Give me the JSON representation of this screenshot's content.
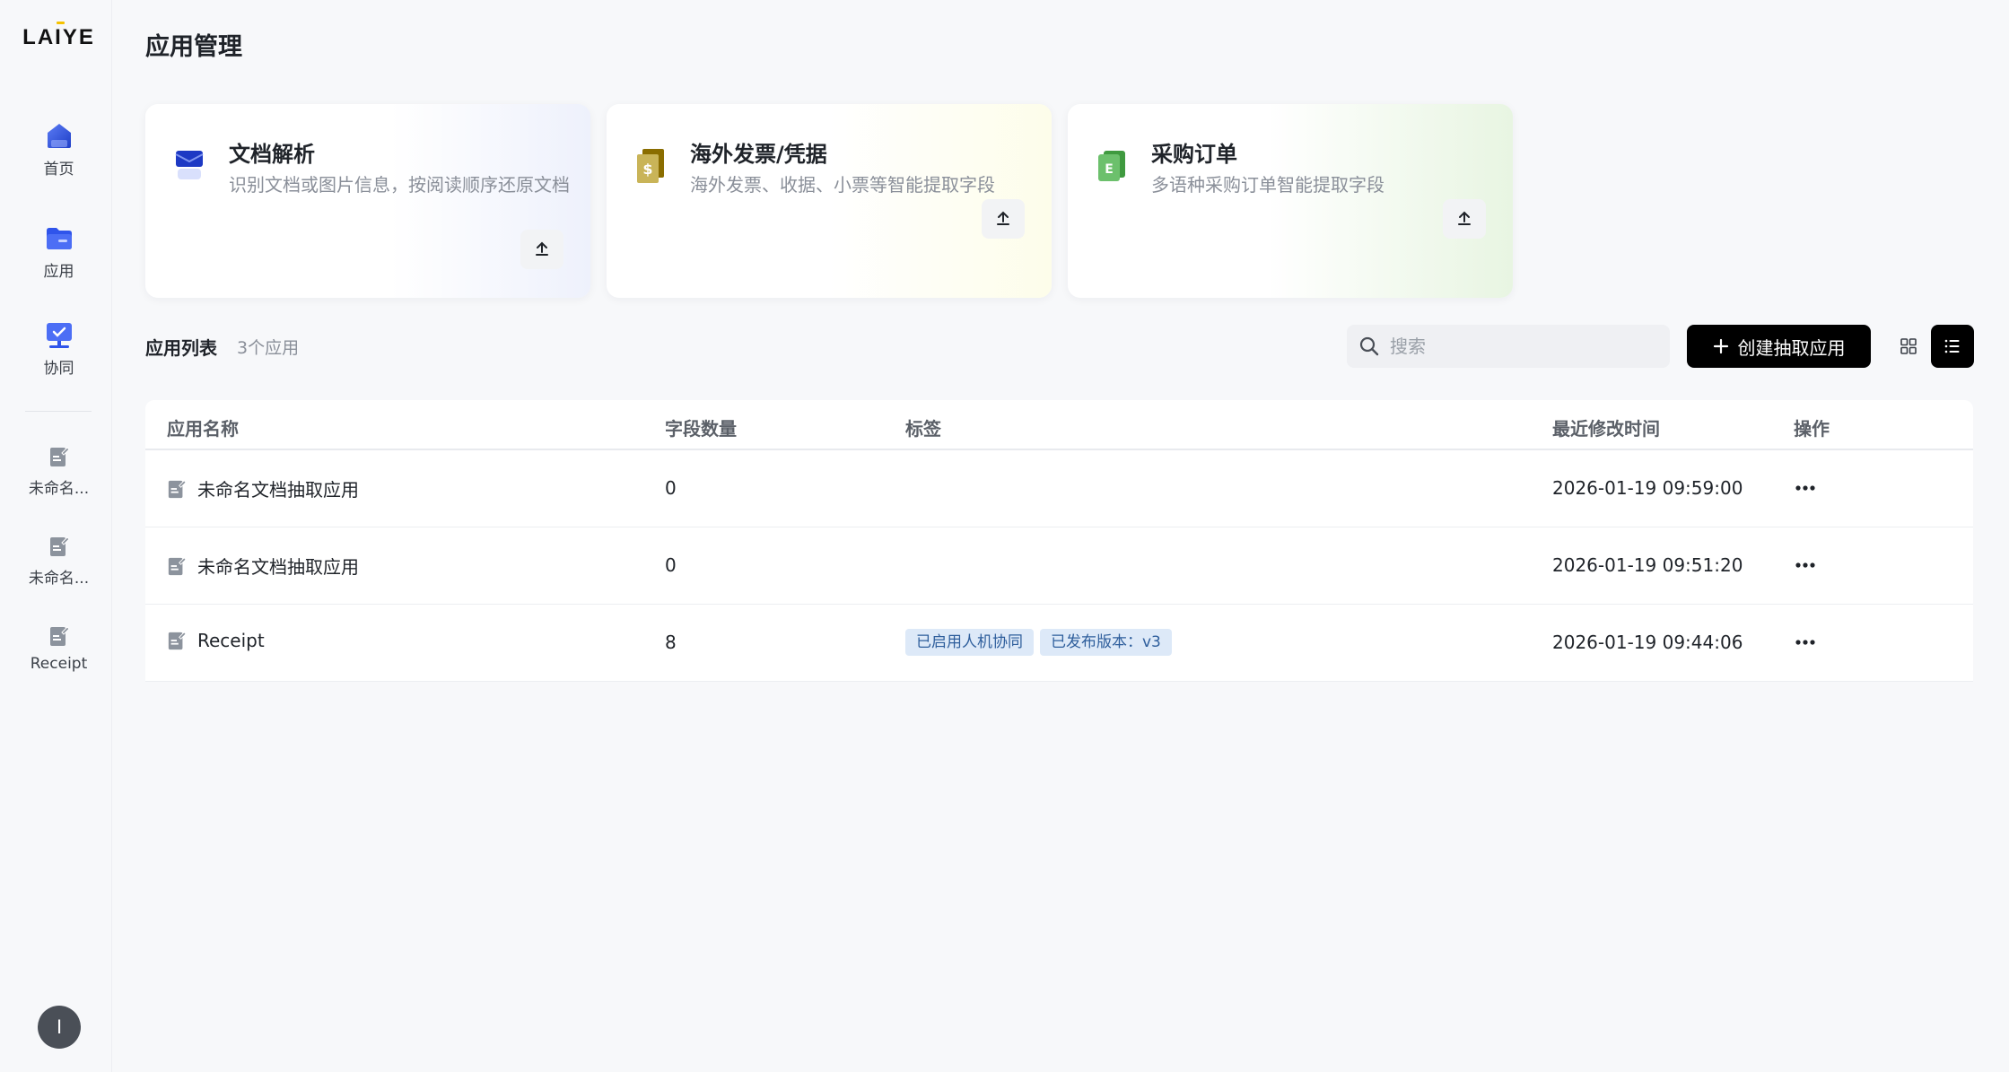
{
  "sidebar": {
    "logo": "LAIYE",
    "nav": [
      {
        "label": "首页",
        "icon": "home-icon"
      },
      {
        "label": "应用",
        "icon": "apps-folder-icon"
      },
      {
        "label": "协同",
        "icon": "collaboration-monitor-icon"
      }
    ],
    "recent": [
      {
        "label": "未命名...",
        "icon": "document-app-icon"
      },
      {
        "label": "未命名...",
        "icon": "document-app-icon"
      },
      {
        "label": "Receipt",
        "icon": "document-app-icon"
      }
    ],
    "avatar_initial": "I"
  },
  "page": {
    "title": "应用管理"
  },
  "templates": [
    {
      "title": "文档解析",
      "desc": "识别文档或图片信息，按阅读顺序还原文档",
      "icon": "document-parse-icon"
    },
    {
      "title": "海外发票/凭据",
      "desc": "海外发票、收据、小票等智能提取字段",
      "icon": "invoice-icon"
    },
    {
      "title": "采购订单",
      "desc": "多语种采购订单智能提取字段",
      "icon": "purchase-order-icon"
    }
  ],
  "list": {
    "title": "应用列表",
    "count": "3个应用",
    "search_placeholder": "搜索",
    "create_label": "创建抽取应用"
  },
  "table": {
    "columns": [
      "应用名称",
      "字段数量",
      "标签",
      "最近修改时间",
      "操作"
    ],
    "rows": [
      {
        "name": "未命名文档抽取应用",
        "fields": "0",
        "tags": [],
        "modified": "2026-01-19 09:59:00"
      },
      {
        "name": "未命名文档抽取应用",
        "fields": "0",
        "tags": [],
        "modified": "2026-01-19 09:51:20"
      },
      {
        "name": "Receipt",
        "fields": "8",
        "tags": [
          "已启用人机协同",
          "已发布版本：v3"
        ],
        "modified": "2026-01-19 09:44:06"
      }
    ]
  },
  "colors": {
    "primary_button": "#000000",
    "tag_bg": "#dde9f8",
    "tag_text": "#2e5e9c",
    "nav_icon_blue": "#2f54eb"
  }
}
